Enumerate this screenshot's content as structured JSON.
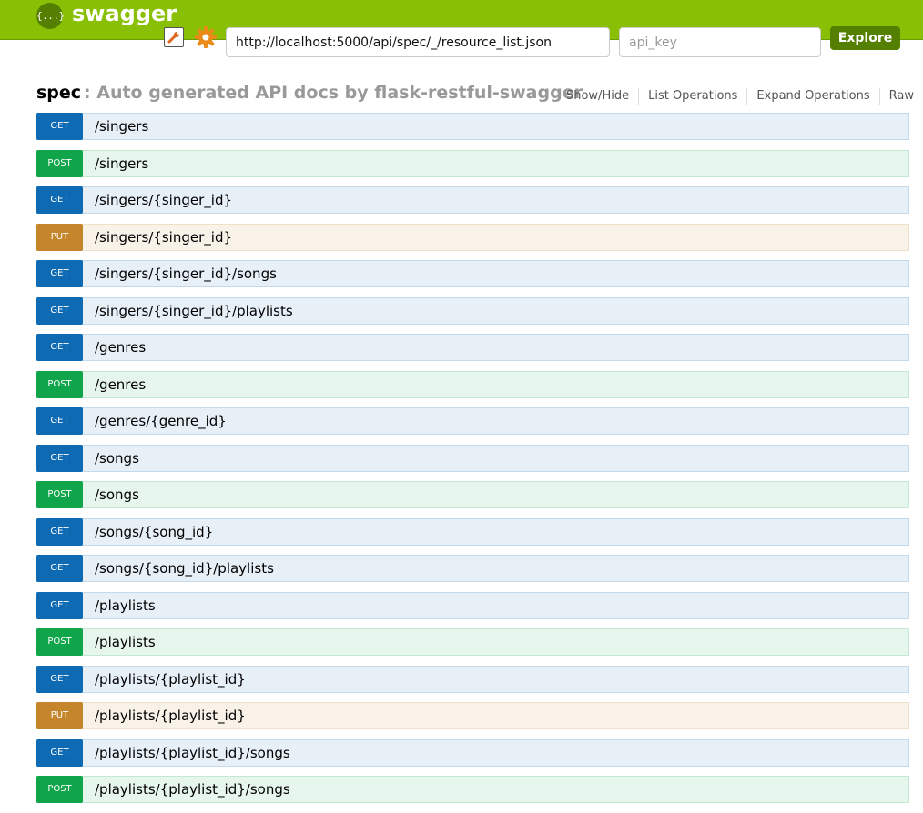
{
  "header": {
    "logo_glyph": "{...}",
    "brand": "swagger",
    "url_value": "http://localhost:5000/api/spec/_/resource_list.json",
    "api_key_placeholder": "api_key",
    "explore_label": "Explore",
    "icons": [
      "wrench-icon",
      "gear-icon"
    ],
    "colors": {
      "header_bg": "#89bf04",
      "explore_bg": "#547f00"
    }
  },
  "spec": {
    "name": "spec",
    "separator": ":",
    "description": "Auto generated API docs by flask-restful-swagger",
    "controls": [
      "Show/Hide",
      "List Operations",
      "Expand Operations",
      "Raw"
    ]
  },
  "method_colors": {
    "GET": "#0f6ab4",
    "POST": "#10a54a",
    "PUT": "#c5862b"
  },
  "operations": [
    {
      "method": "GET",
      "path": "/singers"
    },
    {
      "method": "POST",
      "path": "/singers"
    },
    {
      "method": "GET",
      "path": "/singers/{singer_id}"
    },
    {
      "method": "PUT",
      "path": "/singers/{singer_id}"
    },
    {
      "method": "GET",
      "path": "/singers/{singer_id}/songs"
    },
    {
      "method": "GET",
      "path": "/singers/{singer_id}/playlists"
    },
    {
      "method": "GET",
      "path": "/genres"
    },
    {
      "method": "POST",
      "path": "/genres"
    },
    {
      "method": "GET",
      "path": "/genres/{genre_id}"
    },
    {
      "method": "GET",
      "path": "/songs"
    },
    {
      "method": "POST",
      "path": "/songs"
    },
    {
      "method": "GET",
      "path": "/songs/{song_id}"
    },
    {
      "method": "GET",
      "path": "/songs/{song_id}/playlists"
    },
    {
      "method": "GET",
      "path": "/playlists"
    },
    {
      "method": "POST",
      "path": "/playlists"
    },
    {
      "method": "GET",
      "path": "/playlists/{playlist_id}"
    },
    {
      "method": "PUT",
      "path": "/playlists/{playlist_id}"
    },
    {
      "method": "GET",
      "path": "/playlists/{playlist_id}/songs"
    },
    {
      "method": "POST",
      "path": "/playlists/{playlist_id}/songs"
    }
  ]
}
